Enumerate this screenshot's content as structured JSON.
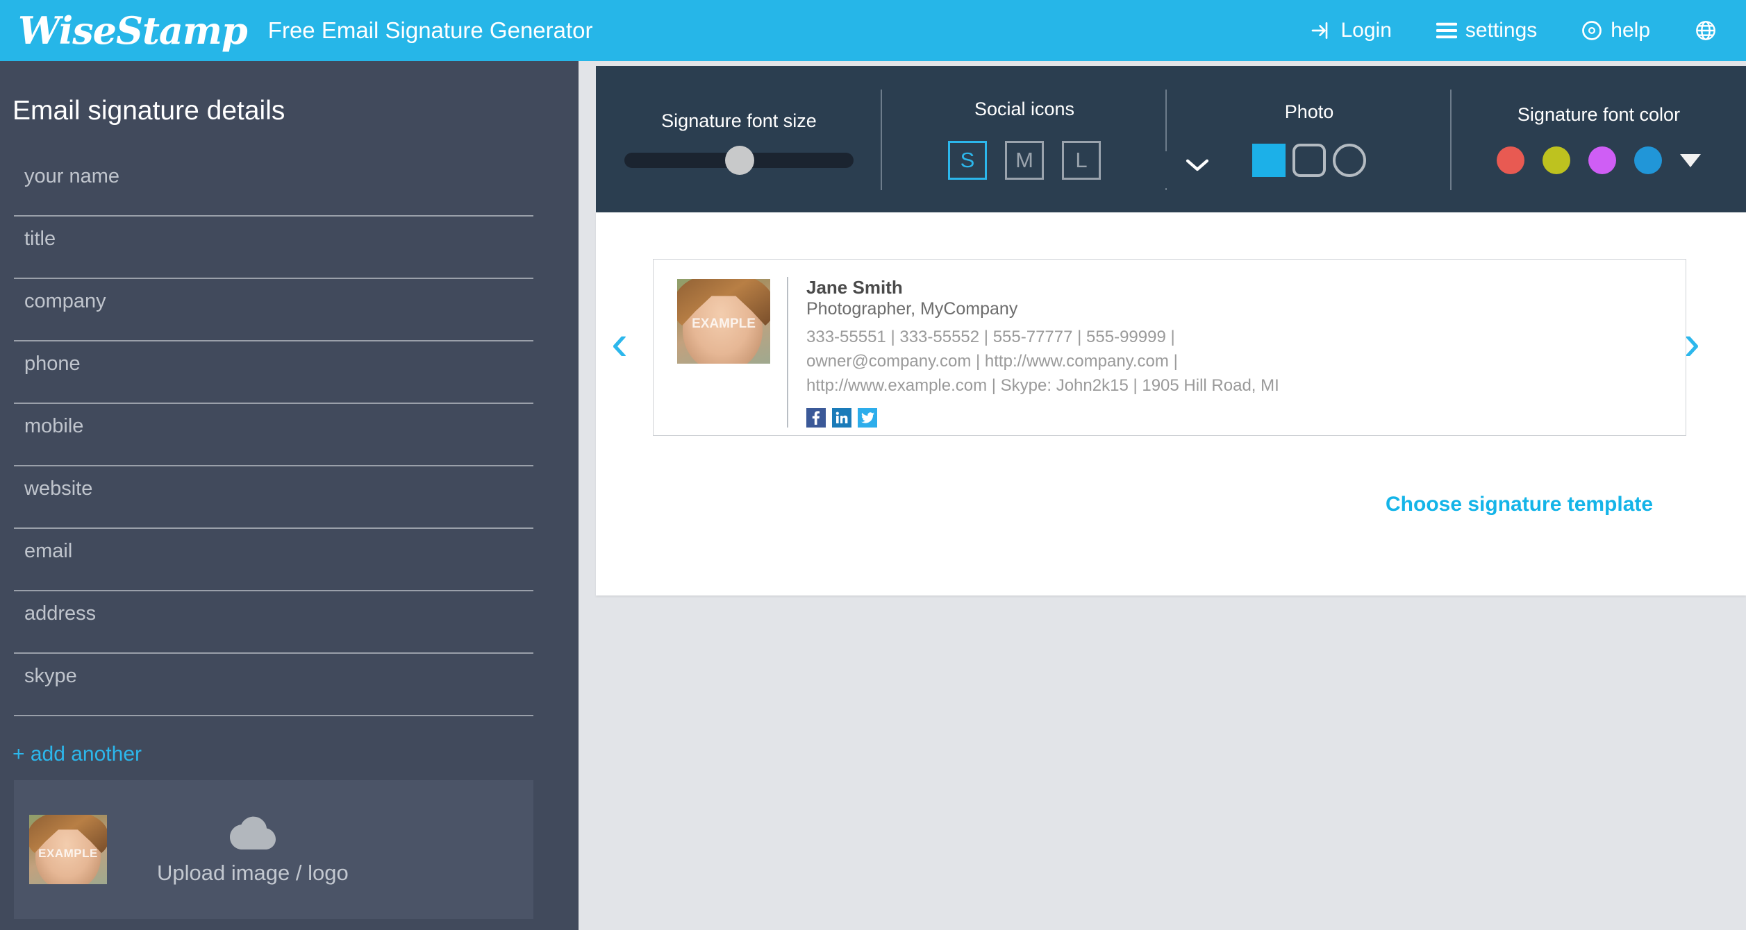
{
  "topbar": {
    "brand": "WiseStamp",
    "title": "Free Email Signature Generator",
    "login_label": "Login",
    "settings_label": "settings",
    "help_label": "help",
    "accent_color": "#26b6e8"
  },
  "sidebar": {
    "title": "Email signature details",
    "fields": [
      {
        "name": "your-name",
        "placeholder": "your name",
        "value": ""
      },
      {
        "name": "title",
        "placeholder": "title",
        "value": ""
      },
      {
        "name": "company",
        "placeholder": "company",
        "value": ""
      },
      {
        "name": "phone",
        "placeholder": "phone",
        "value": ""
      },
      {
        "name": "mobile",
        "placeholder": "mobile",
        "value": ""
      },
      {
        "name": "website",
        "placeholder": "website",
        "value": ""
      },
      {
        "name": "email",
        "placeholder": "email",
        "value": ""
      },
      {
        "name": "address",
        "placeholder": "address",
        "value": ""
      },
      {
        "name": "skype",
        "placeholder": "skype",
        "value": ""
      }
    ],
    "add_another_label": "+ add another",
    "upload_label": "Upload image / logo",
    "upload_thumb_watermark": "EXAMPLE"
  },
  "toolbar": {
    "font_size": {
      "label": "Signature font size",
      "value": 45
    },
    "social_icons": {
      "label": "Social icons",
      "options": [
        "S",
        "M",
        "L"
      ],
      "selected": "S"
    },
    "photo": {
      "label": "Photo",
      "shapes": [
        "square",
        "rounded",
        "circle"
      ],
      "selected": "square",
      "selected_color": "#1cb0e8"
    },
    "font_color": {
      "label": "Signature font color",
      "swatches": [
        "#e85a52",
        "#bec21f",
        "#cf5ef5",
        "#2196d8"
      ],
      "more_label": "▼"
    }
  },
  "preview": {
    "prev_arrow": "‹",
    "next_arrow": "›",
    "collapse_icon": "chevron-down",
    "choose_template_label": "Choose signature template",
    "signature": {
      "photo_watermark": "EXAMPLE",
      "name": "Jane Smith",
      "role": "Photographer, MyCompany",
      "detail_lines": [
        "333-55551 | 333-55552 | 555-77777 | 555-99999 |",
        "owner@company.com | http://www.company.com |",
        "http://www.example.com | Skype: John2k15 | 1905 Hill Road, MI"
      ],
      "social": [
        {
          "name": "facebook",
          "glyph": "f",
          "color": "#3b5998"
        },
        {
          "name": "linkedin",
          "glyph": "in",
          "color": "#1a7bb9"
        },
        {
          "name": "twitter",
          "glyph": "ᴠ",
          "color": "#2dadeb"
        }
      ]
    }
  }
}
